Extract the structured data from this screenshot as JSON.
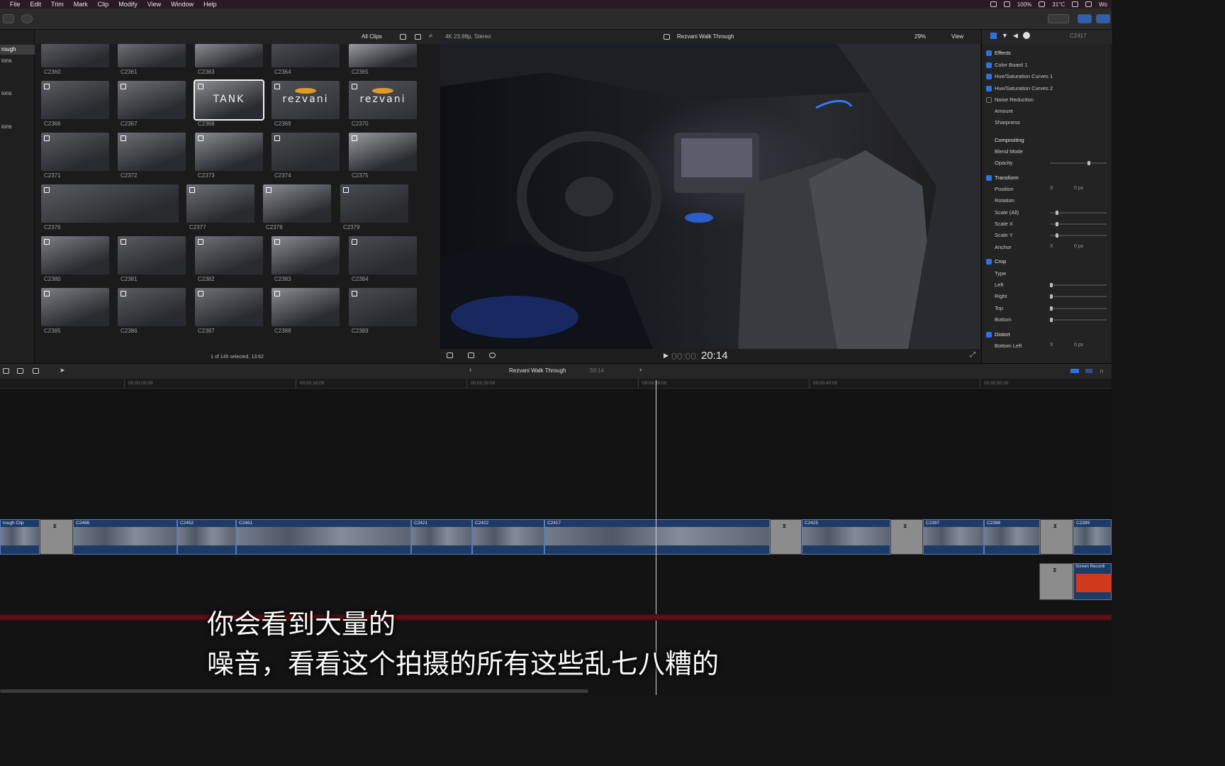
{
  "menubar": {
    "items": [
      "File",
      "Edit",
      "Trim",
      "Mark",
      "Clip",
      "Modify",
      "View",
      "Window",
      "Help"
    ],
    "battery": "100%",
    "temperature": "31°C",
    "right_text": "Wo"
  },
  "sidebar": {
    "items": [
      {
        "label": "rough",
        "selected": true
      },
      {
        "label": "ions",
        "selected": false
      },
      {
        "label": "ions",
        "selected": false
      },
      {
        "label": "ions",
        "selected": false
      }
    ]
  },
  "browser": {
    "filter": "All Clips",
    "footer": "1 of 145 selected, 13:62",
    "clips": [
      {
        "name": "C2360"
      },
      {
        "name": "C2361"
      },
      {
        "name": "C2363"
      },
      {
        "name": "C2364"
      },
      {
        "name": "C2365"
      },
      {
        "name": "C2366"
      },
      {
        "name": "C2367"
      },
      {
        "name": "C2368",
        "selected": true,
        "logo": "TANK"
      },
      {
        "name": "C2369",
        "logo": "rezvani"
      },
      {
        "name": "C2370",
        "logo": "rezvani"
      },
      {
        "name": "C2371"
      },
      {
        "name": "C2372"
      },
      {
        "name": "C2373"
      },
      {
        "name": "C2374"
      },
      {
        "name": "C2375"
      },
      {
        "name": "C2376"
      },
      {
        "name": "C2377"
      },
      {
        "name": "C2378"
      },
      {
        "name": "C2379"
      },
      {
        "name": "C2380"
      },
      {
        "name": "C2381"
      },
      {
        "name": "C2382"
      },
      {
        "name": "C2383"
      },
      {
        "name": "C2384"
      },
      {
        "name": "C2385"
      },
      {
        "name": "C2386"
      },
      {
        "name": "C2387"
      },
      {
        "name": "C2388"
      },
      {
        "name": "C2389"
      }
    ]
  },
  "viewer": {
    "format": "4K 23.98p, Stereo",
    "title": "Rezvani Walk Through",
    "zoom": "29%",
    "view_label": "View",
    "timecode_dim": "00:00:",
    "timecode": "20:14"
  },
  "inspector": {
    "clip_id": "C2417",
    "rows": [
      {
        "label": "Effects",
        "section": true,
        "check": "on"
      },
      {
        "label": "Color Board 1",
        "check": "on"
      },
      {
        "label": "Hue/Saturation Curves 1",
        "check": "on"
      },
      {
        "label": "Hue/Saturation Curves 2",
        "check": "on"
      },
      {
        "label": "Noise Reduction",
        "check": "off"
      },
      {
        "label": "Amount"
      },
      {
        "label": "Sharpness"
      },
      {
        "label": "Compositing",
        "section": true
      },
      {
        "label": "Blend Mode"
      },
      {
        "label": "Opacity",
        "slider": 0.7
      },
      {
        "label": "Transform",
        "section": true,
        "check": "on"
      },
      {
        "label": "Position",
        "x": "X",
        "val": "0 px"
      },
      {
        "label": "Rotation"
      },
      {
        "label": "Scale (All)",
        "slider": 0.1
      },
      {
        "label": "Scale X",
        "slider": 0.1
      },
      {
        "label": "Scale Y",
        "slider": 0.1
      },
      {
        "label": "Anchor",
        "x": "X",
        "val": "0 px"
      },
      {
        "label": "Crop",
        "section": true,
        "check": "on"
      },
      {
        "label": "Type"
      },
      {
        "label": "Left",
        "slider": 0.0
      },
      {
        "label": "Right",
        "slider": 0.0
      },
      {
        "label": "Top",
        "slider": 0.0
      },
      {
        "label": "Bottom",
        "slider": 0.0
      },
      {
        "label": "Distort",
        "section": true,
        "check": "on"
      },
      {
        "label": "Bottom Left",
        "x": "X",
        "val": "0 px"
      }
    ]
  },
  "timeline": {
    "project": "Rezvani Walk Through",
    "duration": "59:14",
    "ruler": [
      "00:00:00:00",
      "00:00:10:00",
      "00:00:20:00",
      "00:00:30:00",
      "00:00:40:00",
      "00:00:50:00"
    ],
    "segments": [
      {
        "name": "rough Clip"
      },
      {
        "name": "C2466"
      },
      {
        "name": "C2452"
      },
      {
        "name": "C2461"
      },
      {
        "name": "C2421"
      },
      {
        "name": "C2422"
      },
      {
        "name": "C2417"
      },
      {
        "name": "C2425"
      },
      {
        "name": "C2397"
      },
      {
        "name": "C2398"
      },
      {
        "name": "C2399"
      }
    ],
    "connected_clip": "Screen Recordi"
  },
  "subtitle": {
    "line1": "你会看到大量的",
    "line2": "噪音，看看这个拍摄的所有这些乱七八糟的"
  }
}
